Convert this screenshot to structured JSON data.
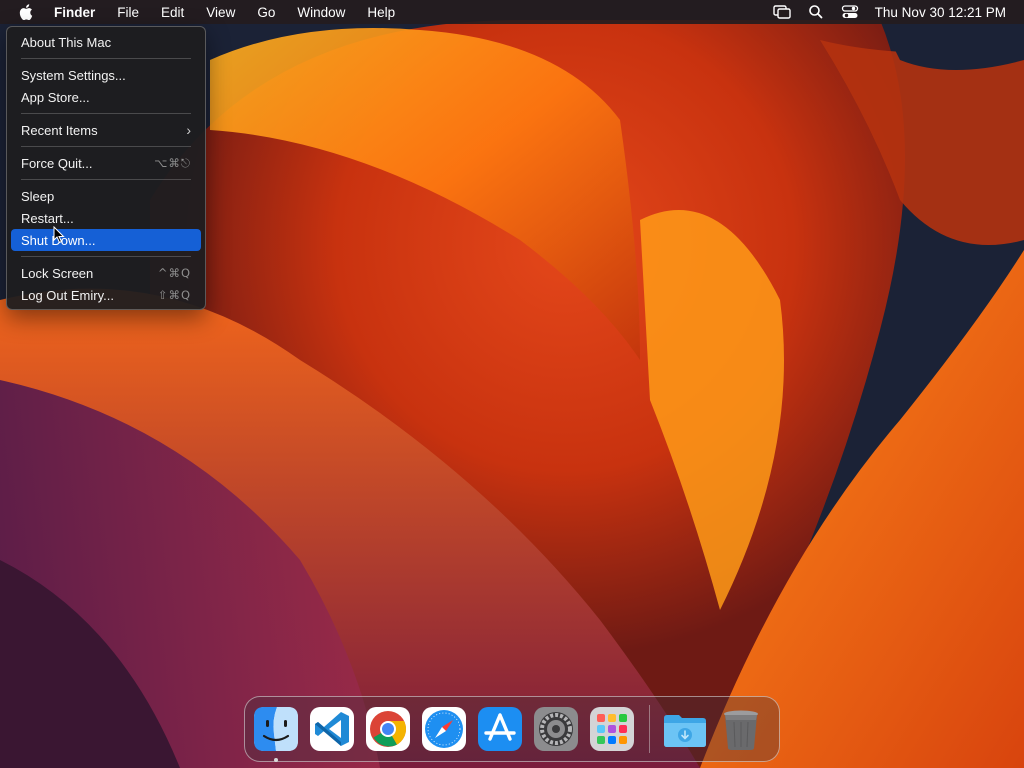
{
  "menubar": {
    "app_name": "Finder",
    "items": [
      "File",
      "Edit",
      "View",
      "Go",
      "Window",
      "Help"
    ],
    "clock": "Thu Nov 30  12:21 PM",
    "status_icons": [
      "screen-mirroring-icon",
      "spotlight-search-icon",
      "control-center-icon"
    ]
  },
  "apple_menu": {
    "items": [
      {
        "label": "About This Mac"
      },
      {
        "label": "System Settings..."
      },
      {
        "label": "App Store..."
      },
      {
        "label": "Recent Items",
        "submenu": true
      },
      {
        "label": "Force Quit...",
        "shortcut": "⌥⌘⎋"
      },
      {
        "label": "Sleep"
      },
      {
        "label": "Restart..."
      },
      {
        "label": "Shut Down...",
        "selected": true
      },
      {
        "label": "Lock Screen",
        "shortcut": "^⌘Q"
      },
      {
        "label": "Log Out Emiry...",
        "shortcut": "⇧⌘Q"
      }
    ],
    "highlight_color": "#1560d6"
  },
  "dock": {
    "apps": [
      {
        "icon": "finder-icon",
        "running": true
      },
      {
        "icon": "vscode-icon"
      },
      {
        "icon": "chrome-icon"
      },
      {
        "icon": "safari-icon"
      },
      {
        "icon": "app-store-icon"
      },
      {
        "icon": "system-settings-icon"
      },
      {
        "icon": "launchpad-icon"
      },
      {
        "icon": "downloads-folder-icon"
      },
      {
        "icon": "trash-icon"
      }
    ]
  }
}
